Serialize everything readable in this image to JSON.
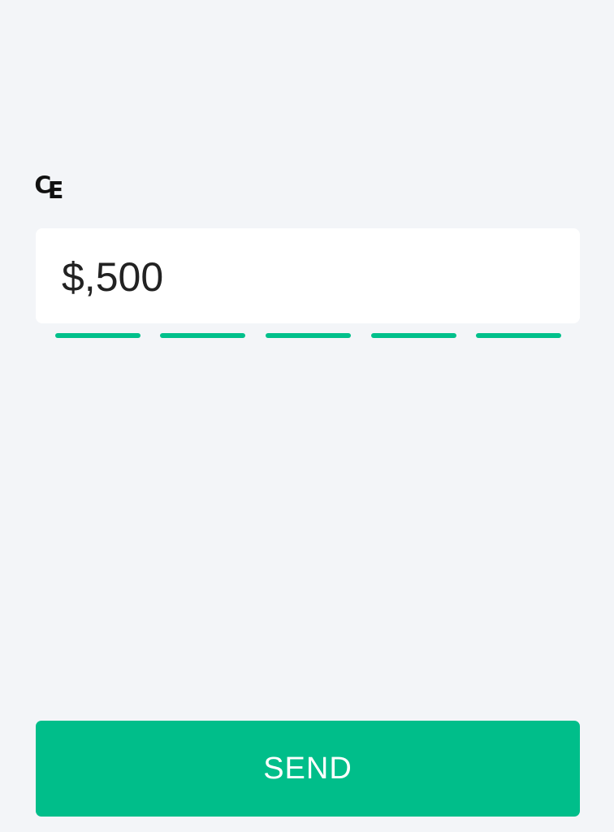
{
  "header": {
    "currency_icon": "currency-icon",
    "currency_glyph": "₠"
  },
  "amount": {
    "value": "$,500"
  },
  "progress": {
    "segments_total": 5,
    "segments_filled": 5,
    "color": "#00c08b"
  },
  "actions": {
    "send_label": "SEND",
    "send_color": "#00be8a"
  }
}
